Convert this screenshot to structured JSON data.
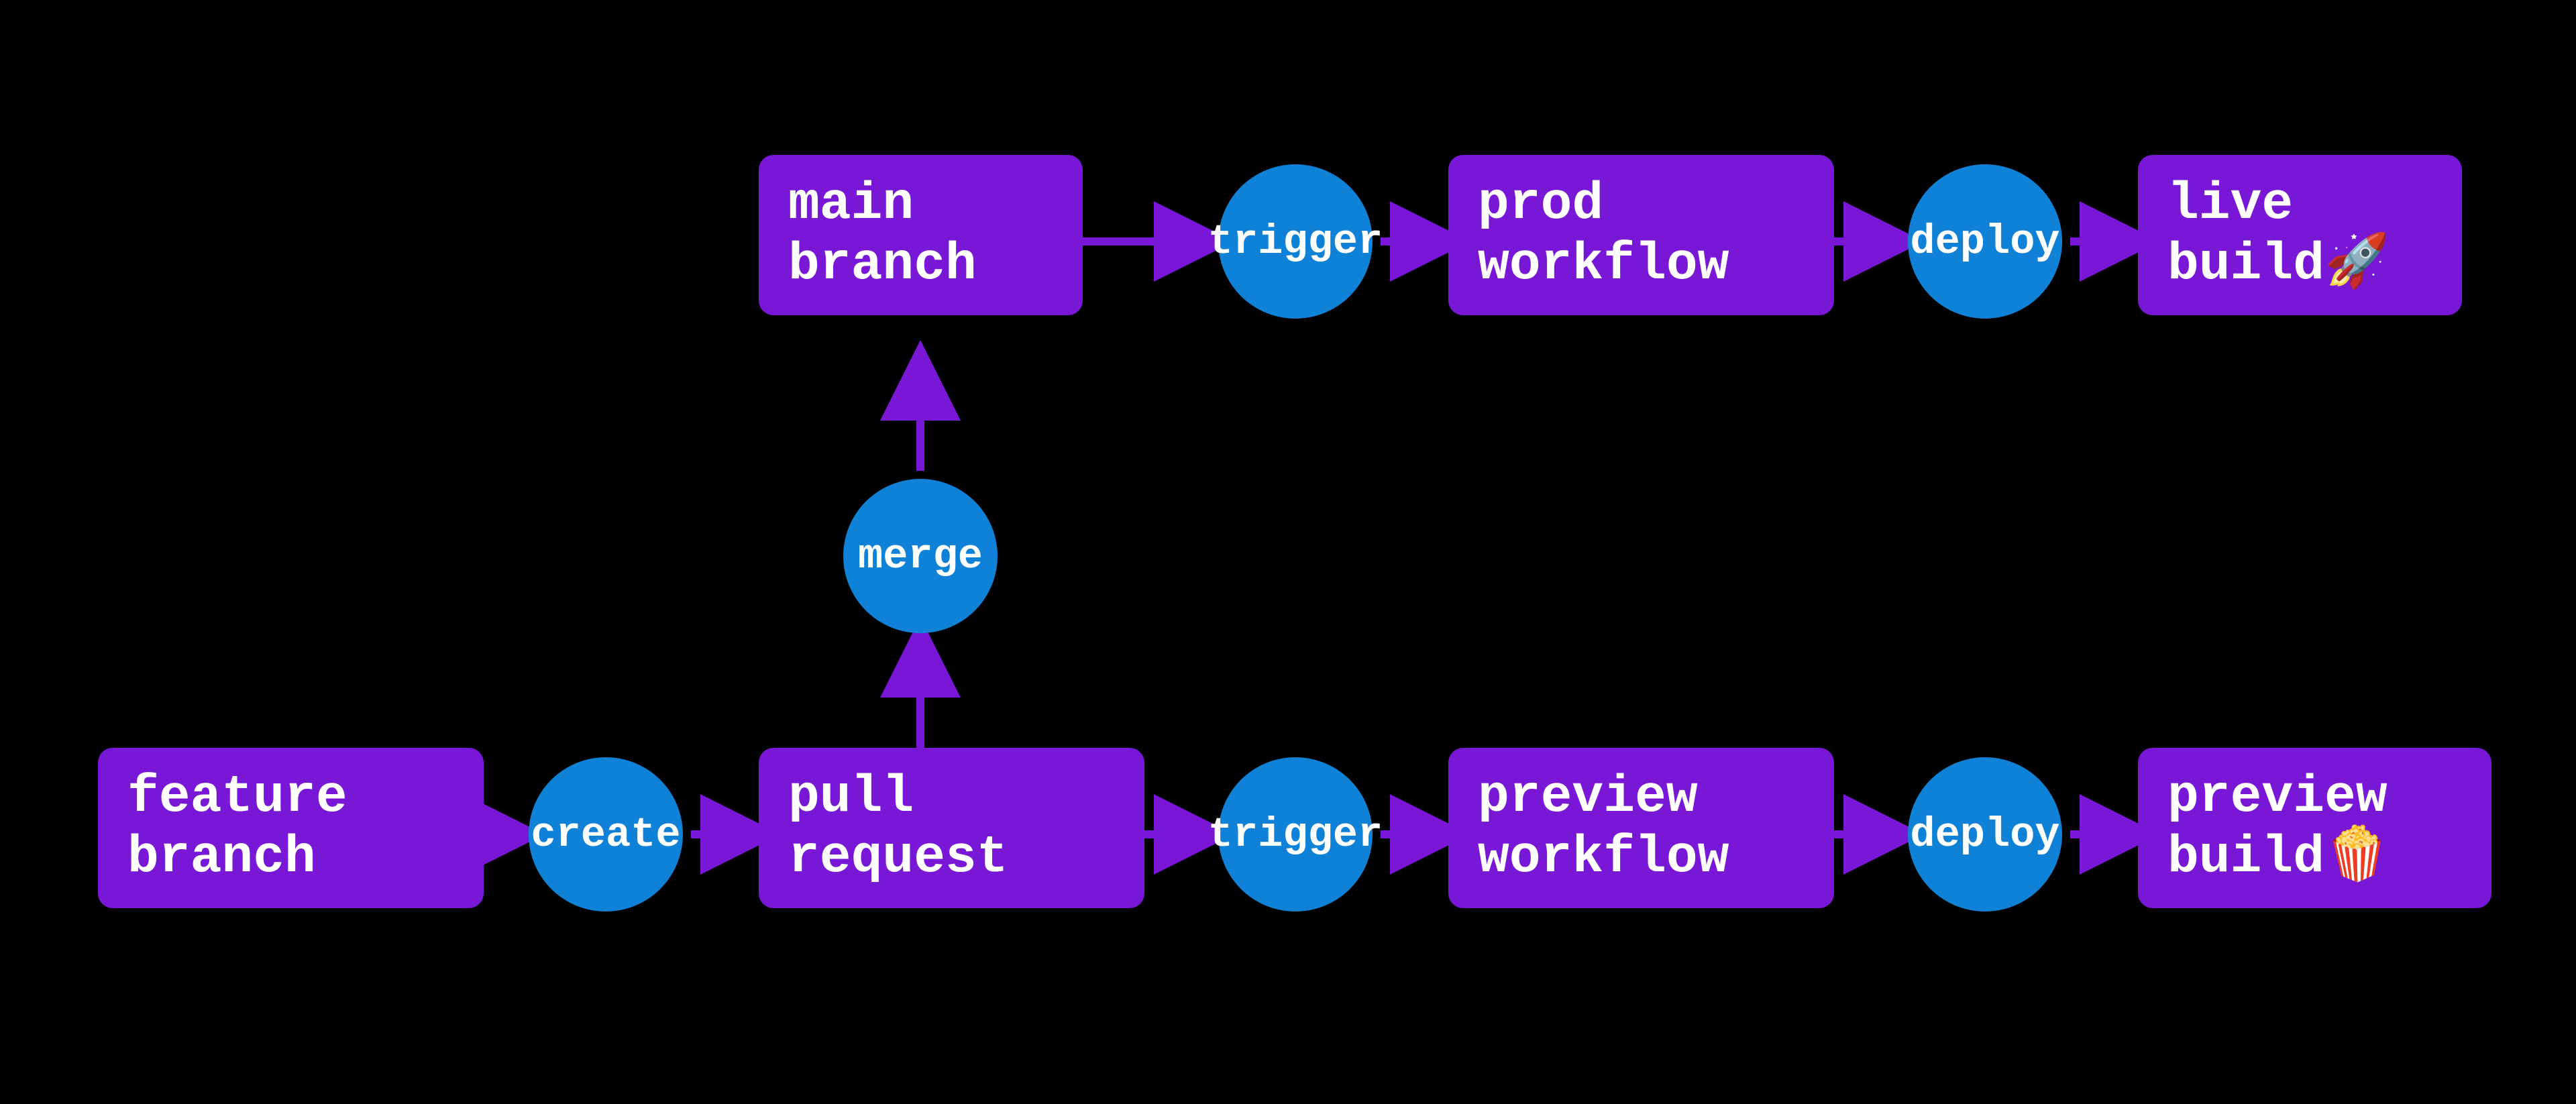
{
  "colors": {
    "background": "#000000",
    "node_fill": "#7817d6",
    "edge_fill": "#0f81d7",
    "arrow": "#7817d6",
    "text": "#ffffff"
  },
  "nodes": {
    "feature_branch": "feature\nbranch",
    "pull_request": "pull\nrequest",
    "main_branch": "main\nbranch",
    "prod_workflow": "prod\nworkflow",
    "live_build": "live\nbuild🚀",
    "preview_workflow": "preview\nworkflow",
    "preview_build": "preview\nbuild🍿"
  },
  "edges": {
    "create": "create",
    "merge": "merge",
    "trigger_top": "trigger",
    "deploy_top": "deploy",
    "trigger_bottom": "trigger",
    "deploy_bottom": "deploy"
  },
  "chart_data": {
    "type": "flowchart",
    "nodes": [
      {
        "id": "feature_branch",
        "label": "feature branch"
      },
      {
        "id": "pull_request",
        "label": "pull request"
      },
      {
        "id": "main_branch",
        "label": "main branch"
      },
      {
        "id": "prod_workflow",
        "label": "prod workflow"
      },
      {
        "id": "live_build",
        "label": "live build🚀"
      },
      {
        "id": "preview_workflow",
        "label": "preview workflow"
      },
      {
        "id": "preview_build",
        "label": "preview build🍿"
      }
    ],
    "edges": [
      {
        "from": "feature_branch",
        "to": "pull_request",
        "label": "create"
      },
      {
        "from": "pull_request",
        "to": "main_branch",
        "label": "merge"
      },
      {
        "from": "pull_request",
        "to": "preview_workflow",
        "label": "trigger"
      },
      {
        "from": "main_branch",
        "to": "prod_workflow",
        "label": "trigger"
      },
      {
        "from": "prod_workflow",
        "to": "live_build",
        "label": "deploy"
      },
      {
        "from": "preview_workflow",
        "to": "preview_build",
        "label": "deploy"
      }
    ]
  }
}
